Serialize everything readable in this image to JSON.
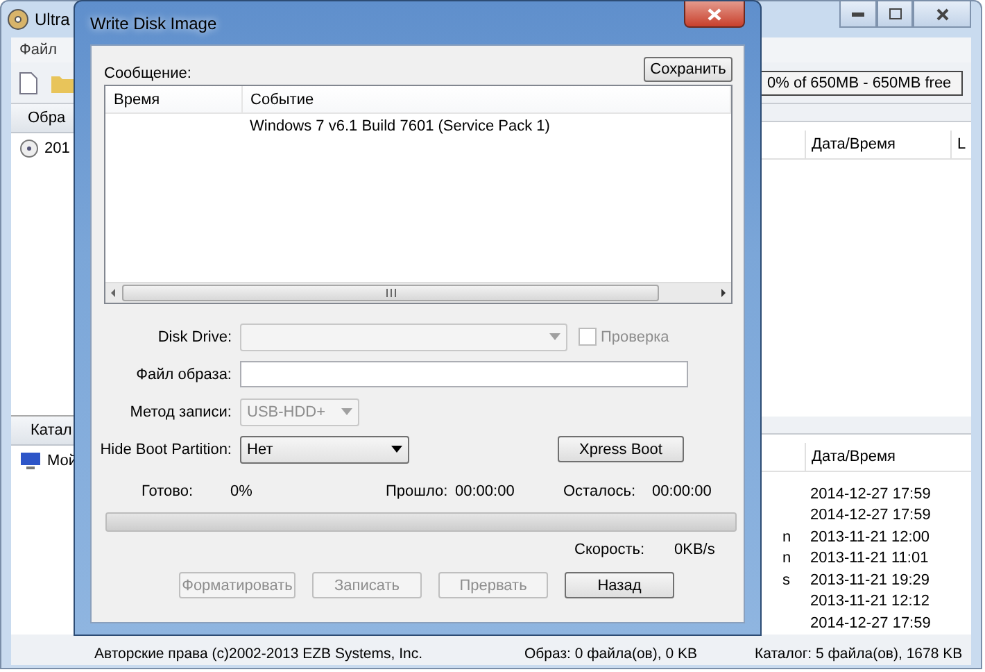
{
  "background_window": {
    "title": "Ultra",
    "menu": [
      "Файл"
    ],
    "capacity": "0% of 650MB - 650MB free",
    "image_pane": {
      "header": "Обра",
      "items": [
        "201"
      ]
    },
    "image_columns": [
      "Дата/Время",
      "L"
    ],
    "catalog_pane": {
      "header": "Катал",
      "items": [
        "Мой"
      ]
    },
    "catalog_columns": [
      "Дата/Время"
    ],
    "catalog_rows": [
      {
        "date": "2014-12-27 17:59"
      },
      {
        "date": "2014-12-27 17:59"
      },
      {
        "fragment": "n",
        "date": "2013-11-21 12:00"
      },
      {
        "fragment": "n",
        "date": "2013-11-21 11:01"
      },
      {
        "fragment": "s",
        "date": "2013-11-21 19:29"
      },
      {
        "date": "2013-11-21 12:12"
      },
      {
        "date": "2014-12-27 17:59"
      }
    ],
    "status_bar": [
      "Авторские права (c)2002-2013 EZB Systems, Inc.",
      "Образ: 0 файла(ов), 0 KB",
      "Каталог: 5 файла(ов), 1678 KB"
    ]
  },
  "dialog": {
    "title": "Write Disk Image",
    "message_label": "Сообщение:",
    "save_button": "Сохранить",
    "log": {
      "columns": [
        "Время",
        "Событие"
      ],
      "rows": [
        {
          "event": "Windows 7 v6.1 Build 7601 (Service Pack 1)"
        }
      ]
    },
    "fields": [
      {
        "kind": "combo",
        "label": "Disk Drive:",
        "disabled": true,
        "checkbox": {
          "label": "Проверка",
          "checked": false,
          "disabled": true
        }
      },
      {
        "kind": "text",
        "label": "Файл образа:"
      },
      {
        "kind": "combo",
        "label": "Метод записи:",
        "value": "USB-HDD+",
        "disabled": true
      },
      {
        "kind": "combo",
        "label": "Hide Boot Partition:",
        "value": "Нет",
        "disabled": false,
        "button": "Xpress Boot"
      }
    ],
    "stats": [
      {
        "label": "Готово:",
        "value": "0%"
      },
      {
        "label": "Прошло:",
        "value": "00:00:00"
      },
      {
        "label": "Осталось:",
        "value": "00:00:00"
      }
    ],
    "progress": {
      "level": 0
    },
    "speed": {
      "label": "Скорость:",
      "value": "0KB/s"
    },
    "buttons": [
      {
        "label": "Форматировать",
        "disabled": true
      },
      {
        "label": "Записать",
        "disabled": true
      },
      {
        "label": "Прервать",
        "disabled": true
      },
      {
        "label": "Назад",
        "disabled": false
      }
    ]
  }
}
